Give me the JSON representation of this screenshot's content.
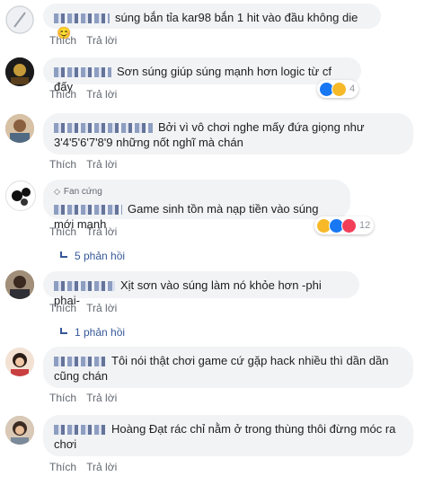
{
  "comments": [
    {
      "text": "súng bắn tỉa kar98 bắn 1 hit vào đầu không die",
      "emoji": "😊"
    },
    {
      "text": "Sơn súng giúp súng mạnh hơn logic từ cf đấy",
      "reaction_count": "4"
    },
    {
      "text": "Bởi vì vô chơi nghe mấy đứa giọng như 3'4'5'6'7'8'9 những nốt nghĩ mà chán"
    },
    {
      "badge": "Fan cứng",
      "text": "Game sinh tồn mà nạp tiền vào súng mới mạnh",
      "reaction_count": "12",
      "replies": "5 phản hồi"
    },
    {
      "text": "Xịt sơn vào súng làm nó khỏe hơn -phi phai-",
      "replies": "1 phản hồi"
    },
    {
      "text": "Tôi nói thật chơi game cứ gặp hack nhiều thì dần dần cũng chán"
    },
    {
      "text": "Hoàng Đạt rác chỉ nằm ở trong thùng thôi đừng móc ra chơi"
    }
  ],
  "actions": {
    "like": "Thích",
    "reply": "Trả lời"
  },
  "colors": {
    "bubble": "#f2f3f5",
    "link": "#365899",
    "action": "#616770",
    "like_blue": "#1877f2",
    "haha_yellow": "#f7b928"
  }
}
